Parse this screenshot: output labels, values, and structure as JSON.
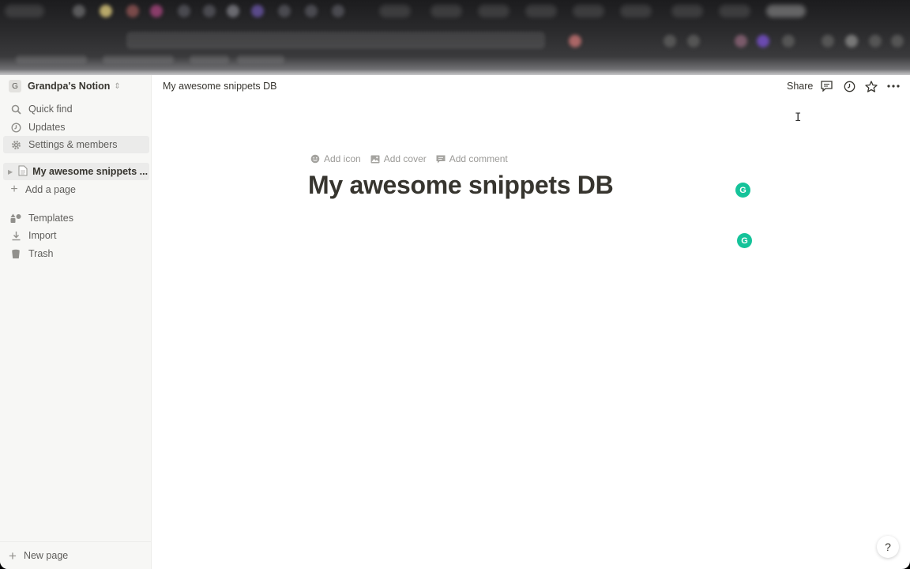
{
  "workspace": {
    "initial": "G",
    "name": "Grandpa's Notion"
  },
  "sidebar": {
    "top_items": [
      {
        "label": "Quick find",
        "icon": "search-icon"
      },
      {
        "label": "Updates",
        "icon": "clock-icon"
      },
      {
        "label": "Settings & members",
        "icon": "gear-icon"
      }
    ],
    "page_item": {
      "label": "My awesome snippets ...",
      "icon": "page-icon"
    },
    "add_page": "Add a page",
    "bottom_items": [
      {
        "label": "Templates",
        "icon": "templates-icon"
      },
      {
        "label": "Import",
        "icon": "download-icon"
      },
      {
        "label": "Trash",
        "icon": "trash-icon"
      }
    ],
    "new_page": "New page"
  },
  "topbar": {
    "breadcrumb": "My awesome snippets DB",
    "share": "Share"
  },
  "page": {
    "actions": [
      {
        "label": "Add icon",
        "icon": "smile-icon"
      },
      {
        "label": "Add cover",
        "icon": "image-icon"
      },
      {
        "label": "Add comment",
        "icon": "comment-icon"
      }
    ],
    "title": "My awesome snippets DB"
  },
  "help": "?",
  "colors": {
    "grammarly": "#15c39a",
    "sidebar_bg": "#f7f7f5",
    "text": "#37352f"
  }
}
